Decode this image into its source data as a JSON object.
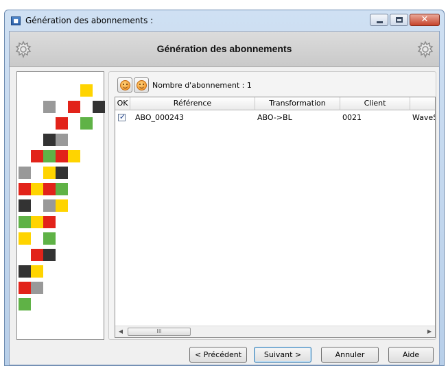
{
  "window": {
    "title": "Génération des abonnements :",
    "controls": [
      "minimize-icon",
      "maximize-icon",
      "close-icon"
    ]
  },
  "banner": {
    "title": "Génération des abonnements"
  },
  "toolbar": {
    "count_label": "Nombre d'abonnement : 1"
  },
  "grid": {
    "columns": [
      "OK",
      "Référence",
      "Transformation",
      "Client",
      ""
    ],
    "rows": [
      {
        "checked": true,
        "reference": "ABO_000243",
        "transformation": "ABO->BL",
        "client": "0021",
        "extra": "WaveSo"
      }
    ]
  },
  "scrollbar": {
    "thumb_glyph": "III",
    "left_arrow": "◀",
    "right_arrow": "▶"
  },
  "buttons": {
    "previous": "< Précédent",
    "next": "Suivant >",
    "cancel": "Annuler",
    "help": "Aide"
  },
  "colors": {
    "red": "#e2231a",
    "yellow": "#ffd400",
    "green": "#5fb246",
    "dark": "#333333",
    "grey": "#999999"
  }
}
